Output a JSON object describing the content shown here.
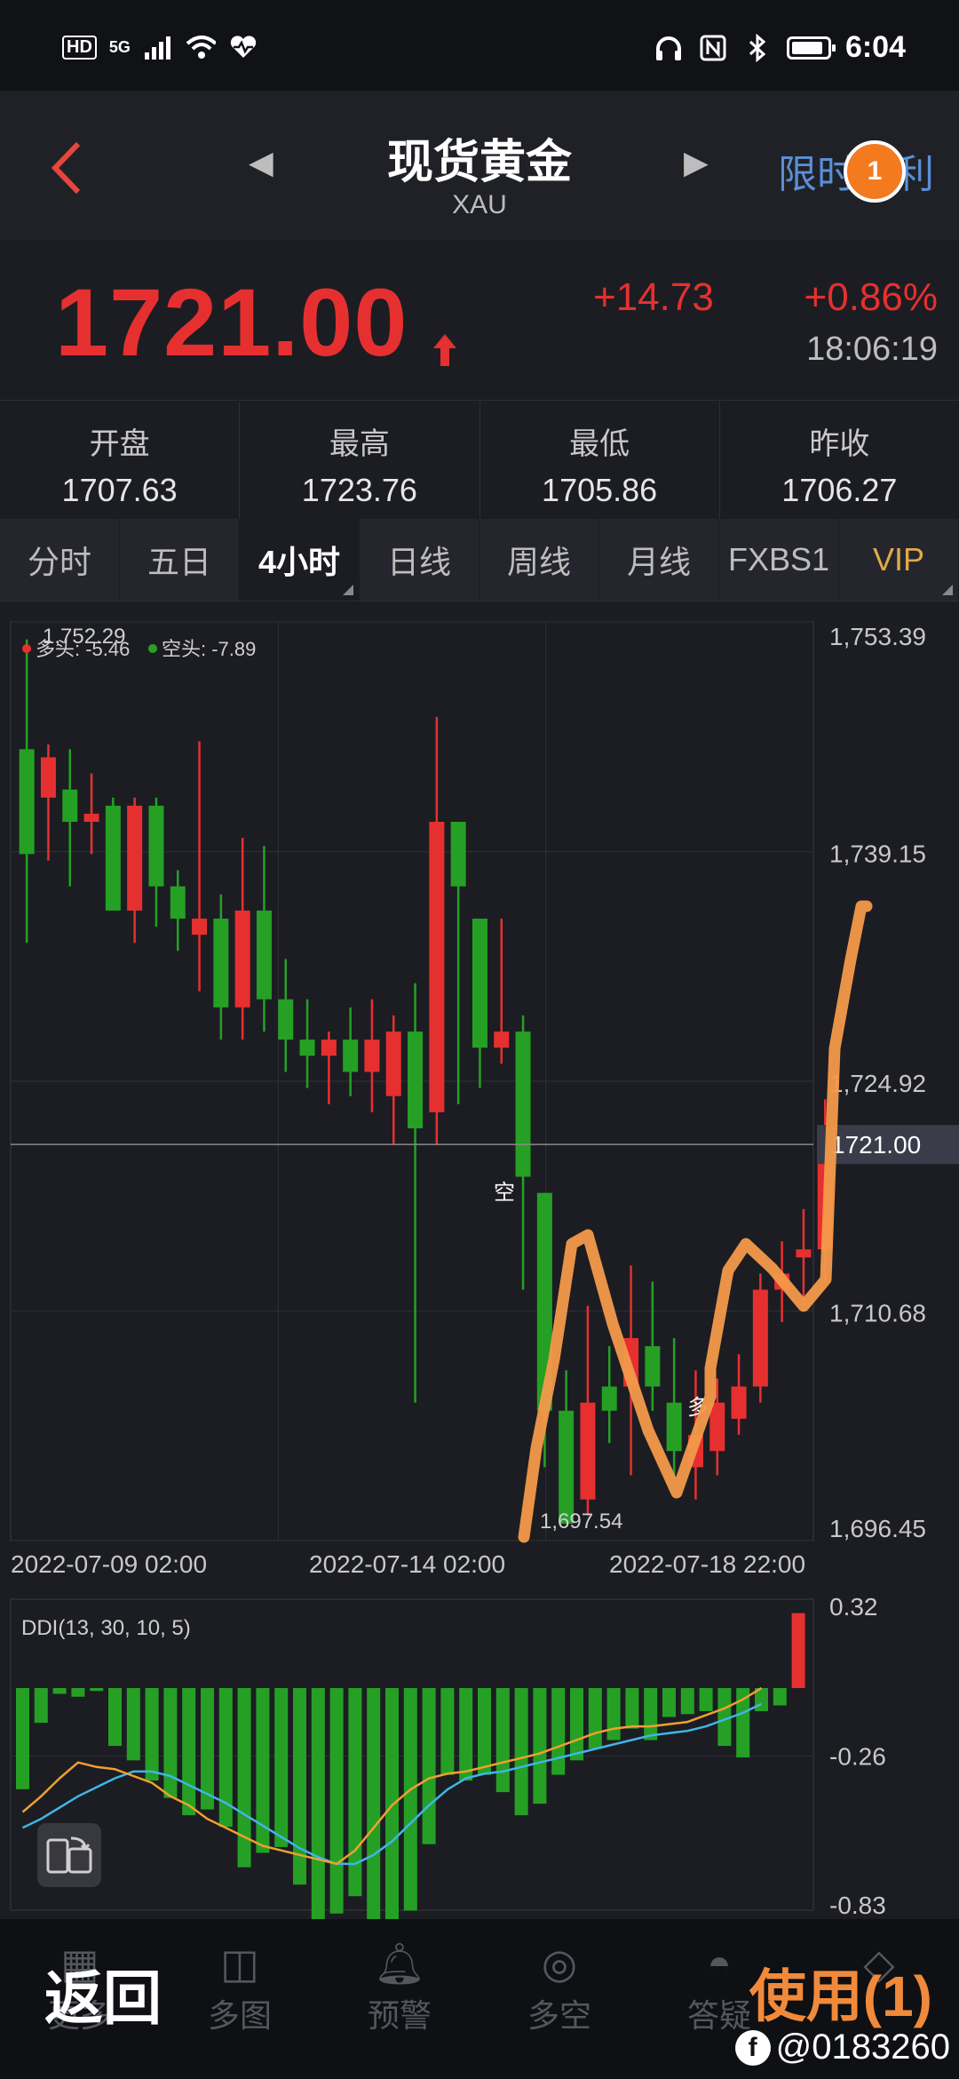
{
  "status": {
    "left_icons": [
      "HD",
      "5G"
    ],
    "time": "6:04"
  },
  "header": {
    "title": "现货黄金",
    "subtitle": "XAU",
    "promo": "限时福利",
    "badge": "1"
  },
  "quote": {
    "price": "1721.00",
    "change": "+14.73",
    "change_pct": "+0.86%",
    "time": "18:06:19",
    "color_up": "#e63030",
    "color_down": "#25a025"
  },
  "stats": [
    {
      "label": "开盘",
      "value": "1707.63"
    },
    {
      "label": "最高",
      "value": "1723.76"
    },
    {
      "label": "最低",
      "value": "1705.86"
    },
    {
      "label": "昨收",
      "value": "1706.27"
    }
  ],
  "tabs": [
    "分时",
    "五日",
    "4小时",
    "日线",
    "周线",
    "月线",
    "FXBS1",
    "VIP"
  ],
  "active_tab": 2,
  "chart_data": [
    {
      "type": "candlestick",
      "legend": {
        "long": "多头: -5.46",
        "short": "空头: -7.89"
      },
      "max_label": "1,752.29",
      "min_label": "1,697.54",
      "price_tag": "1721.00",
      "last_price": 1721.0,
      "ylim": [
        1696.45,
        1753.39
      ],
      "y_ticks": [
        "1,753.39",
        "1,739.15",
        "1,724.92",
        "1,710.68",
        "1,696.45"
      ],
      "x_ticks": [
        "2022-07-09 02:00",
        "2022-07-14 02:00",
        "2022-07-18 22:00"
      ],
      "signals": {
        "short": "空",
        "long": "多"
      },
      "candles": [
        [
          1745.5,
          1752.3,
          1733.5,
          1739.0
        ],
        [
          1742.5,
          1745.8,
          1738.6,
          1745.0
        ],
        [
          1743.0,
          1745.5,
          1737.0,
          1741.0
        ],
        [
          1741.0,
          1744.0,
          1739.0,
          1741.5
        ],
        [
          1742.0,
          1742.5,
          1737.5,
          1735.5
        ],
        [
          1735.5,
          1742.5,
          1733.5,
          1742.0
        ],
        [
          1742.0,
          1742.5,
          1734.5,
          1737.0
        ],
        [
          1737.0,
          1738.0,
          1733.0,
          1735.0
        ],
        [
          1734.0,
          1746.0,
          1730.5,
          1735.0
        ],
        [
          1735.0,
          1736.5,
          1727.5,
          1729.5
        ],
        [
          1729.5,
          1740.0,
          1727.5,
          1735.5
        ],
        [
          1735.5,
          1739.5,
          1728.0,
          1730.0
        ],
        [
          1730.0,
          1732.5,
          1725.5,
          1727.5
        ],
        [
          1727.5,
          1730.0,
          1724.5,
          1726.5
        ],
        [
          1726.5,
          1728.0,
          1723.5,
          1727.5
        ],
        [
          1727.5,
          1729.5,
          1724.0,
          1725.5
        ],
        [
          1725.5,
          1730.0,
          1723.0,
          1727.5
        ],
        [
          1724.0,
          1729.0,
          1721.0,
          1728.0
        ],
        [
          1728.0,
          1731.0,
          1705.0,
          1722.0
        ],
        [
          1723.0,
          1747.5,
          1721.0,
          1741.0
        ],
        [
          1741.0,
          1741.0,
          1723.5,
          1737.0
        ],
        [
          1735.0,
          1735.0,
          1724.5,
          1727.0
        ],
        [
          1727.0,
          1735.0,
          1726.0,
          1728.0
        ],
        [
          1728.0,
          1729.0,
          1712.0,
          1719.0
        ],
        [
          1718.0,
          1718.0,
          1701.0,
          1704.5
        ],
        [
          1704.5,
          1707.0,
          1697.5,
          1697.5
        ],
        [
          1699.0,
          1711.0,
          1698.0,
          1705.0
        ],
        [
          1706.0,
          1708.5,
          1702.5,
          1704.5
        ],
        [
          1706.0,
          1713.5,
          1700.5,
          1709.0
        ],
        [
          1708.5,
          1712.5,
          1704.5,
          1706.0
        ],
        [
          1705.0,
          1709.0,
          1700.0,
          1702.0
        ],
        [
          1701.0,
          1707.0,
          1699.0,
          1703.0
        ],
        [
          1702.0,
          1706.5,
          1700.5,
          1705.0
        ],
        [
          1704.0,
          1708.0,
          1703.0,
          1706.0
        ],
        [
          1706.0,
          1713.0,
          1705.0,
          1712.0
        ],
        [
          1712.0,
          1715.0,
          1710.0,
          1713.0
        ],
        [
          1714.0,
          1717.0,
          1711.0,
          1714.5
        ],
        [
          1714.5,
          1723.8,
          1712.5,
          1721.5
        ],
        [
          1722.0,
          1722.0,
          1720.0,
          1721.0
        ]
      ]
    },
    {
      "type": "bar",
      "title": "DDI(13, 30, 10, 5)",
      "ylim": [
        -0.83,
        0.32
      ],
      "y_ticks": [
        "0.32",
        "-0.26",
        "-0.83"
      ],
      "values": [
        -0.35,
        -0.12,
        -0.02,
        -0.03,
        -0.01,
        -0.2,
        -0.25,
        -0.32,
        -0.38,
        -0.44,
        -0.42,
        -0.48,
        -0.62,
        -0.57,
        -0.55,
        -0.68,
        -0.8,
        -0.78,
        -0.72,
        -0.83,
        -0.82,
        -0.77,
        -0.54,
        -0.3,
        -0.32,
        -0.3,
        -0.36,
        -0.44,
        -0.4,
        -0.3,
        -0.25,
        -0.21,
        -0.18,
        -0.14,
        -0.18,
        -0.1,
        -0.09,
        -0.08,
        -0.2,
        -0.24,
        -0.08,
        -0.06,
        0.3
      ],
      "line_orange": [
        -0.55,
        -0.48,
        -0.4,
        -0.33,
        -0.35,
        -0.36,
        -0.39,
        -0.42,
        -0.48,
        -0.52,
        -0.58,
        -0.62,
        -0.66,
        -0.7,
        -0.72,
        -0.74,
        -0.76,
        -0.78,
        -0.72,
        -0.62,
        -0.52,
        -0.45,
        -0.4,
        -0.38,
        -0.37,
        -0.35,
        -0.33,
        -0.31,
        -0.29,
        -0.26,
        -0.23,
        -0.2,
        -0.18,
        -0.17,
        -0.17,
        -0.16,
        -0.15,
        -0.12,
        -0.09,
        -0.05,
        0.0
      ],
      "line_blue": [
        -0.62,
        -0.58,
        -0.53,
        -0.48,
        -0.44,
        -0.4,
        -0.37,
        -0.37,
        -0.39,
        -0.43,
        -0.47,
        -0.51,
        -0.56,
        -0.61,
        -0.66,
        -0.71,
        -0.75,
        -0.78,
        -0.78,
        -0.74,
        -0.68,
        -0.6,
        -0.52,
        -0.45,
        -0.4,
        -0.38,
        -0.37,
        -0.35,
        -0.33,
        -0.31,
        -0.29,
        -0.27,
        -0.25,
        -0.23,
        -0.21,
        -0.2,
        -0.19,
        -0.17,
        -0.14,
        -0.11,
        -0.07
      ]
    }
  ],
  "bottom_nav": [
    {
      "icon": "grid-icon",
      "label": "更多"
    },
    {
      "icon": "multichart-icon",
      "label": "多图"
    },
    {
      "icon": "bell-icon",
      "label": "预警"
    },
    {
      "icon": "longshort-icon",
      "label": "多空"
    },
    {
      "icon": "answer-icon",
      "label": "答疑"
    },
    {
      "icon": "bag-icon",
      "label": ""
    }
  ],
  "overlay": {
    "back": "返回",
    "use": "使用(1)",
    "watermark": "@0183260"
  }
}
